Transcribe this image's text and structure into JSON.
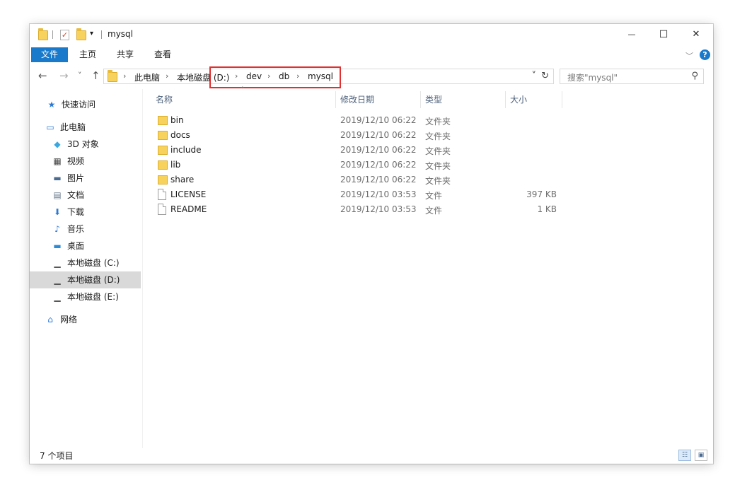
{
  "window": {
    "title": "mysql",
    "controls": {
      "minimize": "—",
      "maximize": "☐",
      "close": "✕"
    }
  },
  "ribbon": {
    "tabs": [
      "文件",
      "主页",
      "共享",
      "查看"
    ],
    "collapse": "﹀",
    "help": "?"
  },
  "nav": {
    "back": "←",
    "forward": "→",
    "recent": "˅",
    "up": "↑",
    "refresh": "↻",
    "dropdown": "˅"
  },
  "address": {
    "crumbs": [
      "此电脑",
      "本地磁盘 (D:)",
      "dev",
      "db",
      "mysql"
    ],
    "separator": "›"
  },
  "search": {
    "placeholder": "搜索\"mysql\"",
    "icon": "search-icon"
  },
  "sidebar": {
    "items": [
      {
        "label": "快速访问",
        "icon": "star-icon",
        "glyph": "★",
        "color": "#2c7ad6"
      },
      {
        "label": "此电脑",
        "icon": "computer-icon",
        "glyph": "▭",
        "color": "#2c7ad6"
      },
      {
        "label": "3D 对象",
        "icon": "cube-icon",
        "glyph": "◆",
        "color": "#39a7e0"
      },
      {
        "label": "视频",
        "icon": "film-icon",
        "glyph": "▦",
        "color": "#444444"
      },
      {
        "label": "图片",
        "icon": "picture-icon",
        "glyph": "▬",
        "color": "#4a6a90"
      },
      {
        "label": "文档",
        "icon": "document-icon",
        "glyph": "▤",
        "color": "#6a7b8c"
      },
      {
        "label": "下载",
        "icon": "download-arrow-icon",
        "glyph": "⬇",
        "color": "#2c7ad6"
      },
      {
        "label": "音乐",
        "icon": "music-note-icon",
        "glyph": "♪",
        "color": "#2c7ad6"
      },
      {
        "label": "桌面",
        "icon": "desktop-icon",
        "glyph": "▬",
        "color": "#2c8ad6"
      },
      {
        "label": "本地磁盘 (C:)",
        "icon": "drive-c-icon",
        "glyph": "▁",
        "color": "#555555"
      },
      {
        "label": "本地磁盘 (D:)",
        "icon": "drive-d-icon",
        "glyph": "▁",
        "color": "#555555"
      },
      {
        "label": "本地磁盘 (E:)",
        "icon": "drive-e-icon",
        "glyph": "▁",
        "color": "#555555"
      },
      {
        "label": "网络",
        "icon": "network-icon",
        "glyph": "⌂",
        "color": "#2c7ad6"
      }
    ]
  },
  "columns": {
    "name": "名称",
    "modified": "修改日期",
    "type": "类型",
    "size": "大小",
    "sort_indicator": "^"
  },
  "files": [
    {
      "name": "bin",
      "modified": "2019/12/10 06:22",
      "type": "文件夹",
      "size": "",
      "kind": "folder"
    },
    {
      "name": "docs",
      "modified": "2019/12/10 06:22",
      "type": "文件夹",
      "size": "",
      "kind": "folder"
    },
    {
      "name": "include",
      "modified": "2019/12/10 06:22",
      "type": "文件夹",
      "size": "",
      "kind": "folder"
    },
    {
      "name": "lib",
      "modified": "2019/12/10 06:22",
      "type": "文件夹",
      "size": "",
      "kind": "folder"
    },
    {
      "name": "share",
      "modified": "2019/12/10 06:22",
      "type": "文件夹",
      "size": "",
      "kind": "folder"
    },
    {
      "name": "LICENSE",
      "modified": "2019/12/10 03:53",
      "type": "文件",
      "size": "397 KB",
      "kind": "file"
    },
    {
      "name": "README",
      "modified": "2019/12/10 03:53",
      "type": "文件",
      "size": "1 KB",
      "kind": "file"
    }
  ],
  "status": {
    "item_count": "7 个项目"
  },
  "colors": {
    "accent": "#1979ca",
    "highlight_box": "#e0302f",
    "selected_bg": "#d9d9d9"
  }
}
